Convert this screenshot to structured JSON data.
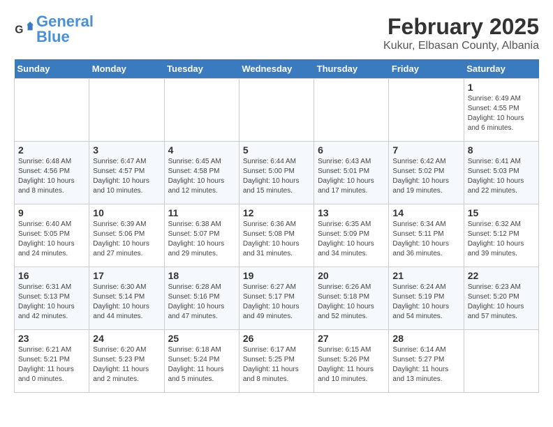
{
  "header": {
    "logo_general": "General",
    "logo_blue": "Blue",
    "month": "February 2025",
    "location": "Kukur, Elbasan County, Albania"
  },
  "days_of_week": [
    "Sunday",
    "Monday",
    "Tuesday",
    "Wednesday",
    "Thursday",
    "Friday",
    "Saturday"
  ],
  "weeks": [
    [
      {
        "day": "",
        "info": ""
      },
      {
        "day": "",
        "info": ""
      },
      {
        "day": "",
        "info": ""
      },
      {
        "day": "",
        "info": ""
      },
      {
        "day": "",
        "info": ""
      },
      {
        "day": "",
        "info": ""
      },
      {
        "day": "1",
        "info": "Sunrise: 6:49 AM\nSunset: 4:55 PM\nDaylight: 10 hours and 6 minutes."
      }
    ],
    [
      {
        "day": "2",
        "info": "Sunrise: 6:48 AM\nSunset: 4:56 PM\nDaylight: 10 hours and 8 minutes."
      },
      {
        "day": "3",
        "info": "Sunrise: 6:47 AM\nSunset: 4:57 PM\nDaylight: 10 hours and 10 minutes."
      },
      {
        "day": "4",
        "info": "Sunrise: 6:45 AM\nSunset: 4:58 PM\nDaylight: 10 hours and 12 minutes."
      },
      {
        "day": "5",
        "info": "Sunrise: 6:44 AM\nSunset: 5:00 PM\nDaylight: 10 hours and 15 minutes."
      },
      {
        "day": "6",
        "info": "Sunrise: 6:43 AM\nSunset: 5:01 PM\nDaylight: 10 hours and 17 minutes."
      },
      {
        "day": "7",
        "info": "Sunrise: 6:42 AM\nSunset: 5:02 PM\nDaylight: 10 hours and 19 minutes."
      },
      {
        "day": "8",
        "info": "Sunrise: 6:41 AM\nSunset: 5:03 PM\nDaylight: 10 hours and 22 minutes."
      }
    ],
    [
      {
        "day": "9",
        "info": "Sunrise: 6:40 AM\nSunset: 5:05 PM\nDaylight: 10 hours and 24 minutes."
      },
      {
        "day": "10",
        "info": "Sunrise: 6:39 AM\nSunset: 5:06 PM\nDaylight: 10 hours and 27 minutes."
      },
      {
        "day": "11",
        "info": "Sunrise: 6:38 AM\nSunset: 5:07 PM\nDaylight: 10 hours and 29 minutes."
      },
      {
        "day": "12",
        "info": "Sunrise: 6:36 AM\nSunset: 5:08 PM\nDaylight: 10 hours and 31 minutes."
      },
      {
        "day": "13",
        "info": "Sunrise: 6:35 AM\nSunset: 5:09 PM\nDaylight: 10 hours and 34 minutes."
      },
      {
        "day": "14",
        "info": "Sunrise: 6:34 AM\nSunset: 5:11 PM\nDaylight: 10 hours and 36 minutes."
      },
      {
        "day": "15",
        "info": "Sunrise: 6:32 AM\nSunset: 5:12 PM\nDaylight: 10 hours and 39 minutes."
      }
    ],
    [
      {
        "day": "16",
        "info": "Sunrise: 6:31 AM\nSunset: 5:13 PM\nDaylight: 10 hours and 42 minutes."
      },
      {
        "day": "17",
        "info": "Sunrise: 6:30 AM\nSunset: 5:14 PM\nDaylight: 10 hours and 44 minutes."
      },
      {
        "day": "18",
        "info": "Sunrise: 6:28 AM\nSunset: 5:16 PM\nDaylight: 10 hours and 47 minutes."
      },
      {
        "day": "19",
        "info": "Sunrise: 6:27 AM\nSunset: 5:17 PM\nDaylight: 10 hours and 49 minutes."
      },
      {
        "day": "20",
        "info": "Sunrise: 6:26 AM\nSunset: 5:18 PM\nDaylight: 10 hours and 52 minutes."
      },
      {
        "day": "21",
        "info": "Sunrise: 6:24 AM\nSunset: 5:19 PM\nDaylight: 10 hours and 54 minutes."
      },
      {
        "day": "22",
        "info": "Sunrise: 6:23 AM\nSunset: 5:20 PM\nDaylight: 10 hours and 57 minutes."
      }
    ],
    [
      {
        "day": "23",
        "info": "Sunrise: 6:21 AM\nSunset: 5:21 PM\nDaylight: 11 hours and 0 minutes."
      },
      {
        "day": "24",
        "info": "Sunrise: 6:20 AM\nSunset: 5:23 PM\nDaylight: 11 hours and 2 minutes."
      },
      {
        "day": "25",
        "info": "Sunrise: 6:18 AM\nSunset: 5:24 PM\nDaylight: 11 hours and 5 minutes."
      },
      {
        "day": "26",
        "info": "Sunrise: 6:17 AM\nSunset: 5:25 PM\nDaylight: 11 hours and 8 minutes."
      },
      {
        "day": "27",
        "info": "Sunrise: 6:15 AM\nSunset: 5:26 PM\nDaylight: 11 hours and 10 minutes."
      },
      {
        "day": "28",
        "info": "Sunrise: 6:14 AM\nSunset: 5:27 PM\nDaylight: 11 hours and 13 minutes."
      },
      {
        "day": "",
        "info": ""
      }
    ]
  ]
}
